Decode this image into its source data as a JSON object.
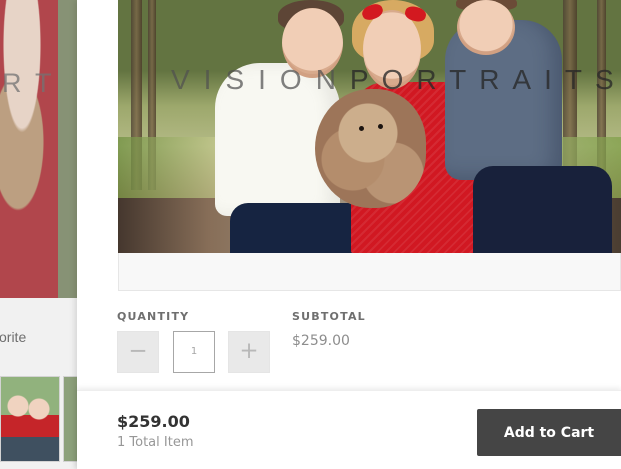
{
  "background": {
    "watermark": "RT",
    "favorite_text": "orite"
  },
  "main_image": {
    "watermark_light": "VISION",
    "watermark_dark": "PORTRAITS"
  },
  "quantity": {
    "label": "QUANTITY",
    "value": "1",
    "decrement_icon": "minus-icon",
    "increment_icon": "plus-icon",
    "decrement_symbol": "−",
    "increment_symbol": "+"
  },
  "subtotal": {
    "label": "SUBTOTAL",
    "value": "$259.00"
  },
  "cart": {
    "total_price": "$259.00",
    "total_items": "1 Total Item",
    "add_to_cart_label": "Add to Cart"
  },
  "colors": {
    "button_dark": "#454545",
    "text_primary": "#333333",
    "text_muted": "#979797",
    "dress_red": "#d11822"
  }
}
